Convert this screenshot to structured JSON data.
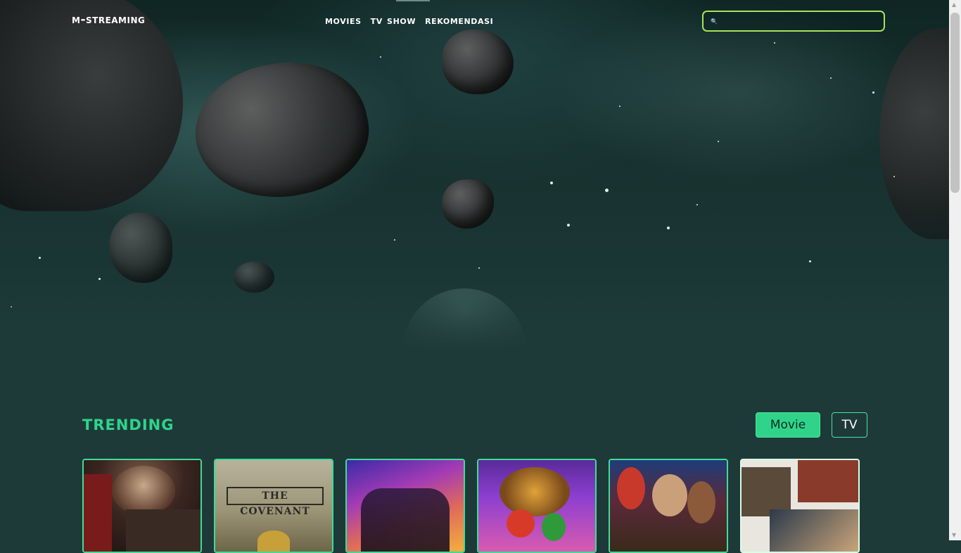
{
  "brand": "m-streaming",
  "nav": {
    "links": [
      "movies",
      "tv show",
      "rekomendasi"
    ]
  },
  "search": {
    "placeholder": "",
    "icon": "search-icon"
  },
  "trending": {
    "title": "trending",
    "tabs": {
      "movie": "Movie",
      "tv": "TV",
      "active": "movie"
    }
  },
  "posters": [
    {
      "title": "",
      "theme": "horror"
    },
    {
      "title": "THE COVENANT",
      "theme": "war"
    },
    {
      "title": "",
      "theme": "guardians"
    },
    {
      "title": "",
      "theme": "mario"
    },
    {
      "title": "",
      "theme": "dungeons"
    },
    {
      "title": "",
      "theme": "collage"
    }
  ],
  "colors": {
    "accent": "#2fd48a",
    "search_border": "#a6e35a",
    "background": "#1d3a38"
  }
}
